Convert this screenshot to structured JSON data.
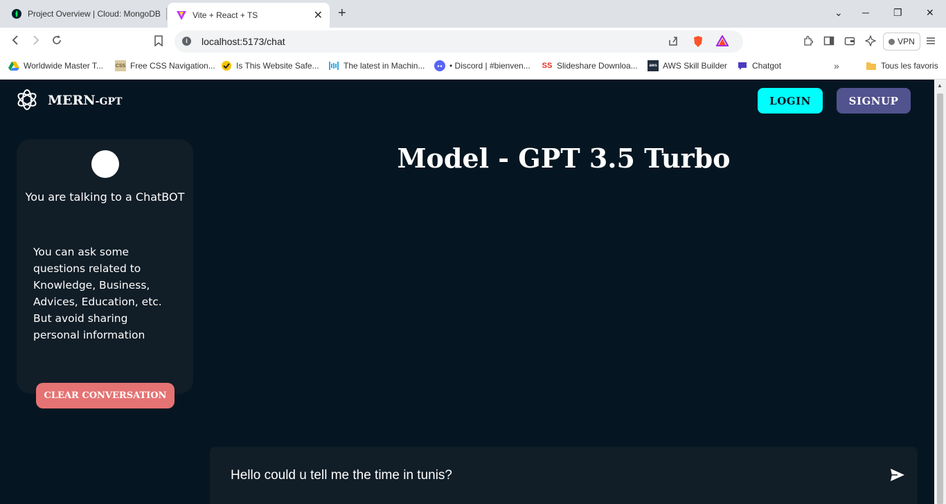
{
  "browser": {
    "tabs": [
      {
        "title": "Project Overview | Cloud: MongoDB"
      },
      {
        "title": "Vite + React + TS"
      }
    ],
    "url": "localhost:5173/chat",
    "vpn_label": "VPN",
    "bookmarks": [
      {
        "label": "Worldwide Master T...",
        "icon": "google-drive-icon"
      },
      {
        "label": "Free CSS Navigation...",
        "icon": "css-icon"
      },
      {
        "label": "Is This Website Safe...",
        "icon": "check-icon"
      },
      {
        "label": "The latest in Machin...",
        "icon": "papers-icon"
      },
      {
        "label": "• Discord | #bienven...",
        "icon": "discord-icon"
      },
      {
        "label": "Slideshare Downloa...",
        "icon": "ss-icon"
      },
      {
        "label": "AWS Skill Builder",
        "icon": "aws-icon"
      },
      {
        "label": "Chatgot",
        "icon": "chat-bubble-icon"
      }
    ],
    "other_bookmarks": "Tous les favoris"
  },
  "app": {
    "brand_main": "MERN",
    "brand_suffix": "-GPT",
    "login_label": "LOGIN",
    "signup_label": "SIGNUP",
    "sidebar": {
      "talking_text": "You are talking to a ChatBOT",
      "hint_text": "You can ask some questions related to Knowledge, Business, Advices, Education, etc. But avoid sharing personal information",
      "clear_label": "CLEAR CONVERSATION"
    },
    "model_title": "Model - GPT 3.5 Turbo",
    "chat_input_value": "Hello could u tell me the time in tunis?"
  },
  "colors": {
    "background": "#051622",
    "panel": "#111d27",
    "login": "#00fffc",
    "signup": "#51538f",
    "clear": "#e57373"
  }
}
